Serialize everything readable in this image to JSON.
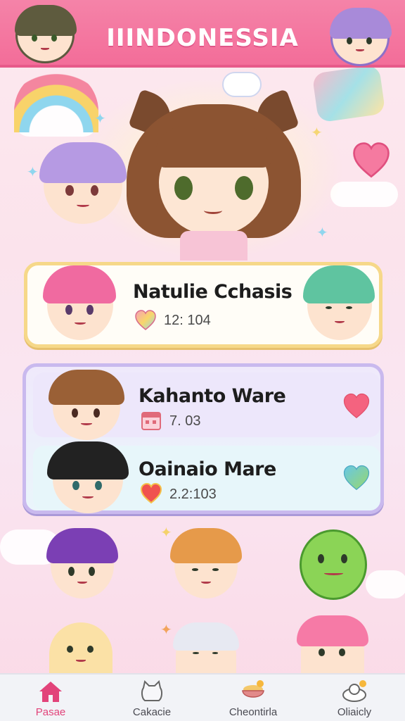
{
  "header": {
    "title": "IIINDONESSIA"
  },
  "cards": [
    {
      "name": "Natulie Cchasis",
      "stat": "12: 104",
      "stat_icon": "rainbow-heart-icon"
    },
    {
      "name": "Kahanto Ware",
      "stat": "7.  03",
      "stat_icon": "calendar-icon",
      "action_icon": "heart-icon"
    },
    {
      "name": "Oainaio Mare",
      "stat": "2.2:103",
      "stat_icon": "heart-icon",
      "action_icon": "heart-icon"
    }
  ],
  "tabbar": {
    "items": [
      {
        "label": "Pasae",
        "icon": "home-icon",
        "active": true
      },
      {
        "label": "Cakacie",
        "icon": "cat-icon",
        "active": false
      },
      {
        "label": "Cheontirla",
        "icon": "bowl-icon",
        "active": false
      },
      {
        "label": "Oliaicly",
        "icon": "pet-bed-icon",
        "active": false
      }
    ]
  },
  "colors": {
    "header": "#f36d99",
    "accent": "#e2437a",
    "card_border_gold": "#f6d889",
    "card_border_lavender": "#c9b9ee"
  }
}
